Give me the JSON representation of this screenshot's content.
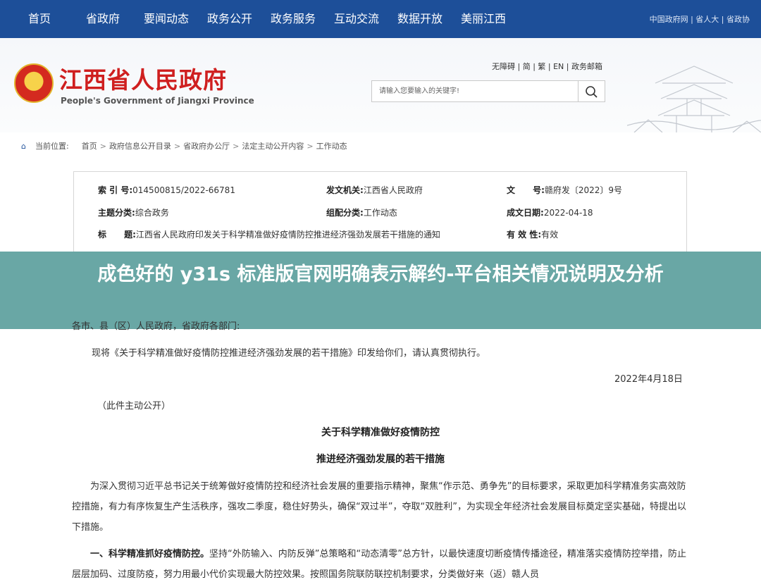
{
  "topnav": {
    "items": [
      "首页",
      "省政府",
      "要闻动态",
      "政务公开",
      "政务服务",
      "互动交流",
      "数据开放",
      "美丽江西"
    ],
    "right_links": "中国政府网 | 省人大 | 省政协"
  },
  "header": {
    "site_name": "江西省人民政府",
    "site_name_en": "People's Government of Jiangxi Province",
    "util_links": "无障碍 | 简 | 繁 | EN | 政务邮箱",
    "search_placeholder": "请输入您要输入的关键字!"
  },
  "breadcrumb": {
    "label": "当前位置:",
    "items": [
      "首页",
      "政府信息公开目录",
      "省政府办公厅",
      "法定主动公开内容",
      "工作动态"
    ]
  },
  "meta": {
    "index_label": "索 引 号:",
    "index_value": "014500815/2022-66781",
    "issuer_label": "发文机关:",
    "issuer_value": "江西省人民政府",
    "docno_label": "文      号:",
    "docno_value": "赣府发〔2022〕9号",
    "topic_label": "主题分类:",
    "topic_value": "综合政务",
    "category_label": "组配分类:",
    "category_value": "工作动态",
    "date_label": "成文日期:",
    "date_value": "2022-04-18",
    "title_label": "标      题:",
    "title_value": "江西省人民政府印发关于科学精准做好疫情防控推进经济强劲发展若干措施的通知",
    "validity_label": "有 效 性:",
    "validity_value": "有效"
  },
  "banner": {
    "title": "成色好的 y31s 标准版官网明确表示解约-平台相关情况说明及分析"
  },
  "document": {
    "addressee": "各市、县（区）人民政府，省政府各部门:",
    "intro": "现将《关于科学精准做好疫情防控推进经济强劲发展的若干措施》印发给你们，请认真贯彻执行。",
    "date": "2022年4月18日",
    "disclosure": "（此件主动公开）",
    "heading_1": "关于科学精准做好疫情防控",
    "heading_2": "推进经济强劲发展的若干措施",
    "para_1": "为深入贯彻习近平总书记关于统筹做好疫情防控和经济社会发展的重要指示精神，聚焦“作示范、勇争先”的目标要求，采取更加科学精准务实高效防控措施，有力有序恢复生产生活秩序，强攻二季度，稳住好势头，确保“双过半”，夺取“双胜利”，为实现全年经济社会发展目标奠定坚实基础，特提出以下措施。",
    "para_2_bold": "一、科学精准抓好疫情防控。",
    "para_2": "坚持“外防输入、内防反弹”总策略和“动态清零”总方针，以最快速度切断疫情传播途径，精准落实疫情防控举措，防止层层加码、过度防疫，努力用最小代价实现最大防控效果。按照国务院联防联控机制要求，分类做好来（返）赣人员"
  },
  "colors": {
    "nav_blue": "#1d4f99",
    "site_red": "#cf1f1f",
    "banner_teal": "#5ea09e"
  }
}
